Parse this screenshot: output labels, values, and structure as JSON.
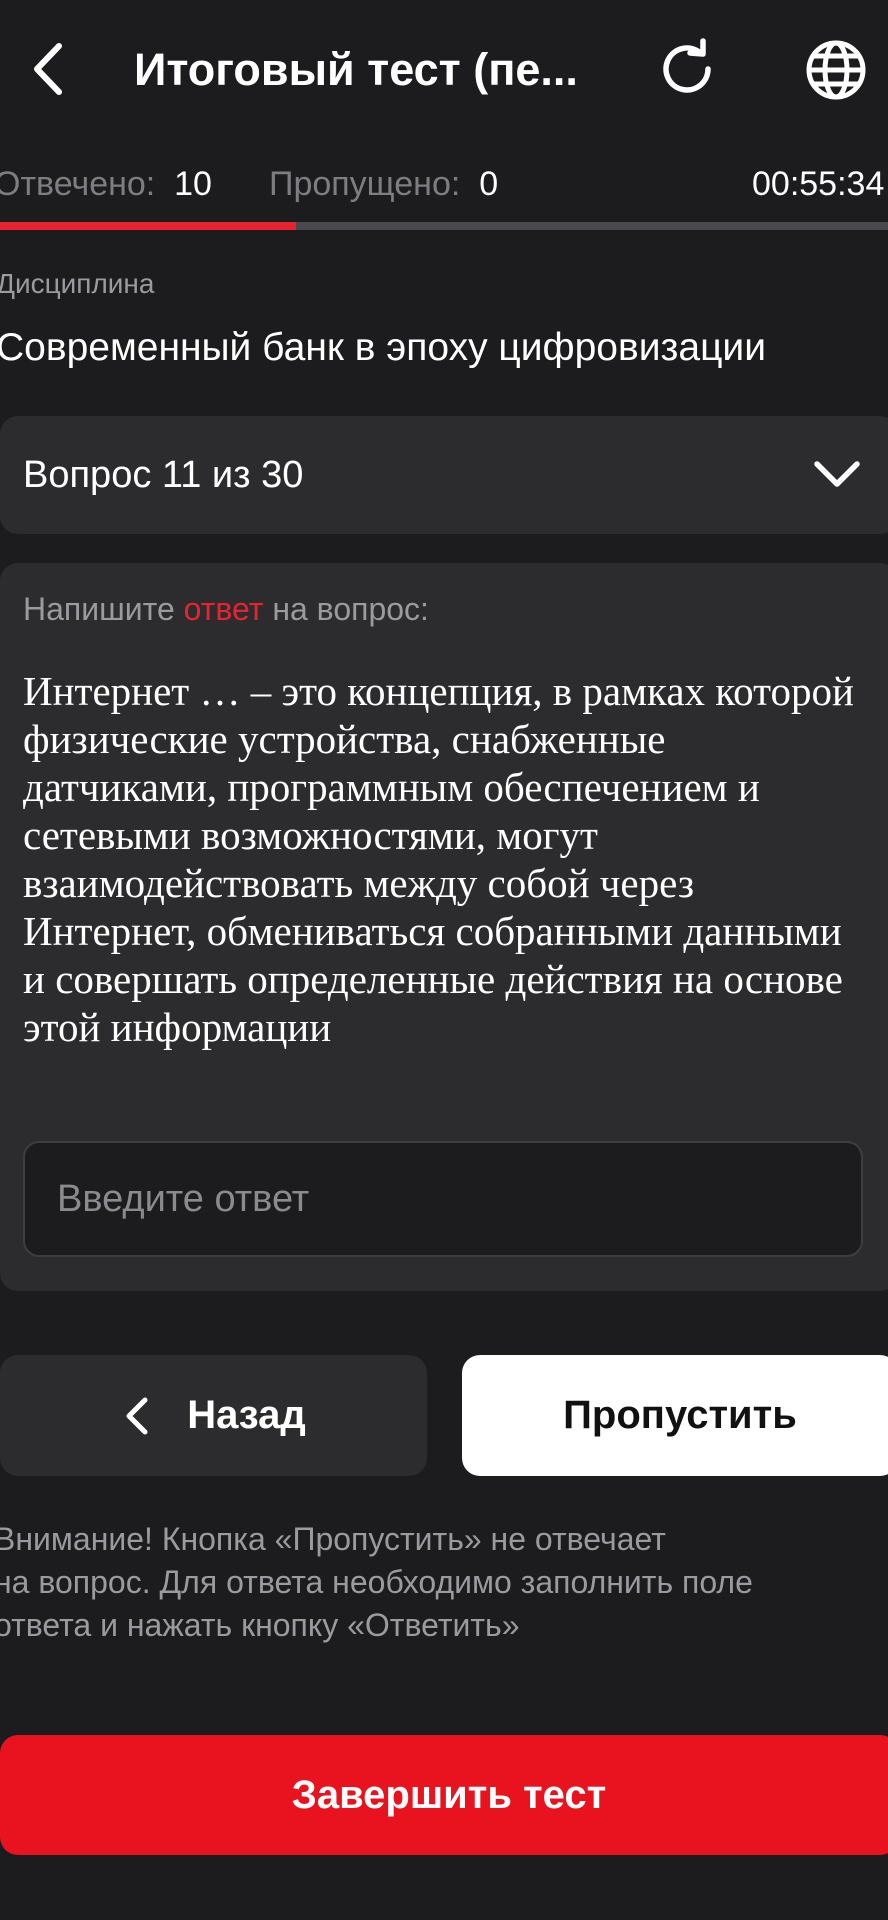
{
  "header": {
    "title": "Итоговый тест (пе...",
    "back_icon": "arrow-left-icon",
    "refresh_icon": "refresh-icon",
    "language_icon": "globe-icon"
  },
  "stats": {
    "answered_label": "Отвечено:",
    "answered_value": "10",
    "skipped_label": "Пропущено:",
    "skipped_value": "0",
    "timer": "00:55:34",
    "progress_fraction": 0.333
  },
  "discipline": {
    "label": "Дисциплина",
    "name": "Современный банк в эпоху цифровизации"
  },
  "question_selector": {
    "counter": "Вопрос 11 из 30",
    "icon": "chevron-down-icon"
  },
  "question": {
    "prompt_before": "Напишите ",
    "prompt_accent": "ответ",
    "prompt_after": " на вопрос:",
    "text": "Интернет … – это концепция, в рамках которой физические устройства, снабженные датчиками, программным обеспечением и сетевыми возможностями, могут взаимодействовать между собой через Интернет, обмениваться собранными данными и совершать определенные действия на основе этой информации",
    "answer_value": "",
    "answer_placeholder": "Введите ответ"
  },
  "nav": {
    "back_label": "Назад",
    "skip_label": "Пропустить"
  },
  "warning": "Внимание! Кнопка «Пропустить» не отвечает\nна вопрос. Для ответа необходимо заполнить поле\nответа и нажать кнопку «Ответить»",
  "finish_label": "Завершить тест",
  "colors": {
    "background": "#1c1c1e",
    "card": "#2c2c2e",
    "accent": "#e5242f",
    "finish_button": "#e8131f"
  }
}
